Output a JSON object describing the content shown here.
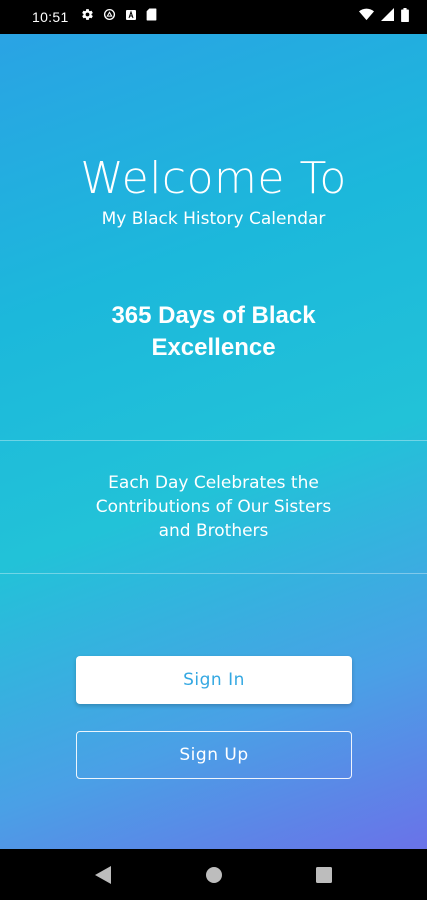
{
  "status_bar": {
    "time": "10:51",
    "left_icons": [
      "settings-icon",
      "shield-icon",
      "font-icon",
      "sd-card-icon"
    ],
    "right_icons": [
      "wifi-icon",
      "signal-icon",
      "battery-icon"
    ]
  },
  "welcome": {
    "title": "Welcome To",
    "subtitle": "My Black History Calendar"
  },
  "tagline": {
    "line1": "365 Days of Black",
    "line2": "Excellence"
  },
  "description": {
    "line1": "Each Day Celebrates the",
    "line2": "Contributions of Our Sisters",
    "line3": "and Brothers"
  },
  "actions": {
    "sign_in_label": "Sign In",
    "sign_up_label": "Sign Up"
  },
  "nav_bar": {
    "icons": [
      "back-icon",
      "home-icon",
      "recents-icon"
    ]
  },
  "colors": {
    "gradient_start": "#2aa3e4",
    "gradient_mid": "#22c2d8",
    "gradient_end": "#6a72e8",
    "sign_in_text": "#34a8e2"
  }
}
